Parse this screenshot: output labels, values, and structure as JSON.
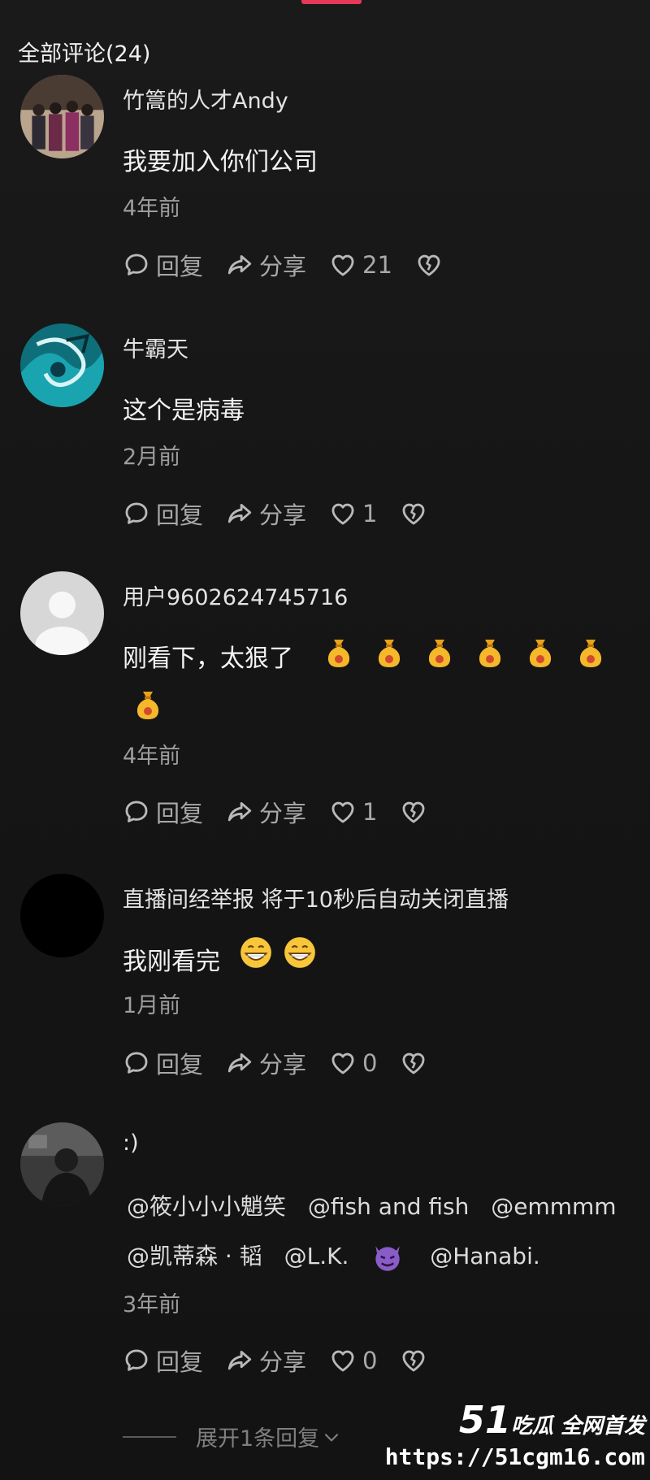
{
  "header": {
    "title": "全部评论(24)"
  },
  "actions": {
    "reply": "回复",
    "share": "分享"
  },
  "comments": [
    {
      "username": "竹篙的人才Andy",
      "text": "我要加入你们公司",
      "time": "4年前",
      "likes": "21",
      "avatar": "group-photo"
    },
    {
      "username": "牛霸天",
      "text": "这个是病毒",
      "time": "2月前",
      "likes": "1",
      "avatar": "teal-dragon-art"
    },
    {
      "username": "用户9602624745716",
      "text": "刚看下，太狠了",
      "time": "4年前",
      "likes": "1",
      "avatar": "default-user",
      "emoji": "money-bag-icon",
      "emoji_count": 7
    },
    {
      "username": "直播间经举报 将于10秒后自动关闭直播",
      "text": "我刚看完",
      "time": "1月前",
      "likes": "0",
      "avatar": "black-circle",
      "emoji": "grinning-face-icon",
      "emoji_count": 2
    },
    {
      "username": ":)",
      "time": "3年前",
      "likes": "0",
      "avatar": "dark-photo",
      "mentions_line1": [
        "@筱小小小魈笑",
        "@fish and fish",
        "@emmmm"
      ],
      "mentions_line2": [
        "@凯蒂森 · 韬",
        "@L.K.",
        "@Hanabi."
      ],
      "mention_emoji": "purple-devil-icon"
    }
  ],
  "expand": {
    "label": "展开1条回复"
  },
  "watermark": {
    "logo_num": "51",
    "logo_text": "吃瓜 全网首发",
    "url": "https://51cgm16.com"
  },
  "colors": {
    "accent": "#e6395a",
    "background": "#161616",
    "muted": "#9d9d9d"
  }
}
